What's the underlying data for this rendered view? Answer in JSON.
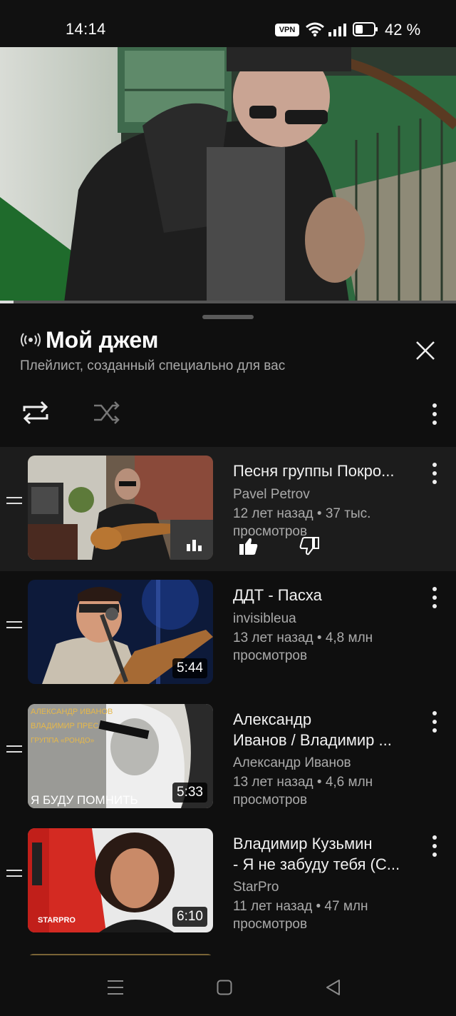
{
  "status_bar": {
    "time": "14:14",
    "vpn": "VPN",
    "battery": "42 %",
    "battery_level": 0.42
  },
  "video": {
    "progress": 0.03
  },
  "playlist": {
    "title": "Мой джем",
    "subtitle": "Плейлист, созданный специально для вас",
    "icons": {
      "header": "radio-broadcast-icon",
      "loop": "loop-icon",
      "shuffle": "shuffle-icon",
      "more": "more-vert-icon",
      "close": "close-icon"
    }
  },
  "items": [
    {
      "title": "Песня группы Покро...",
      "channel": "Pavel Petrov",
      "meta1": "12 лет назад • 37 тыс.",
      "meta2": "просмотров",
      "duration": "",
      "playing": true
    },
    {
      "title": "ДДТ - Пасха",
      "channel": "invisibleua",
      "meta1": "13 лет назад • 4,8 млн",
      "meta2": "просмотров",
      "duration": "5:44"
    },
    {
      "title1": "Александр",
      "title2": "Иванов / Владимир ...",
      "channel": "Александр Иванов",
      "meta1": "13 лет назад • 4,6 млн",
      "meta2": "просмотров",
      "duration": "5:33",
      "thumb_lines": [
        "АЛЕКСАНДР ИВАНОВ",
        "ВЛАДИМИР ПРЕС",
        "ГРУППА «РОНДО»",
        "Я БУДУ ПОМНИТЬ"
      ]
    },
    {
      "title1": "Владимир Кузьмин",
      "title2": "- Я не забуду тебя (С...",
      "channel": "StarPro",
      "meta1": "11 лет назад • 47 млн",
      "meta2": "просмотров",
      "duration": "6:10",
      "thumb_logo": "STARPRO"
    }
  ],
  "colors": {
    "background": "#0f0f0f",
    "active_row": "#1c1c1c",
    "secondary_text": "#aaaaaa"
  }
}
